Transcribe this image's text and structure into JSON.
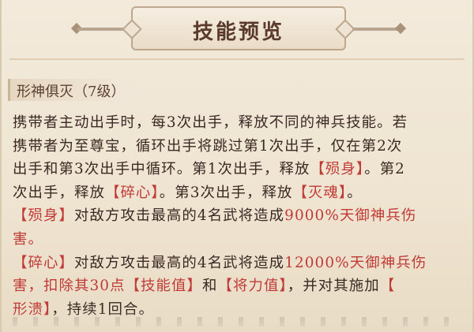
{
  "header": {
    "title": "技能预览"
  },
  "skill": {
    "name": "形神俱灭（7级）"
  },
  "description": {
    "l1": "携带者主动出手时，每3次出手，释放不同的神兵技能。若",
    "l2": "携带者为至尊宝，循环出手将跳过第1次出手，仅在第2次",
    "l3a": "出手和第3次出手中循环。第1次出手，释放",
    "l3b": "【殒身】",
    "l3c": "。第2",
    "l4a": "次出手，释放",
    "l4b": "【碎心】",
    "l4c": "。第3次出手，释放",
    "l4d": "【灭魂】",
    "l4e": "。",
    "l5a": "【殒身】",
    "l5b": "对敌方攻击最高的4名武将造成",
    "l5c": "9000%",
    "l5d": "天御神兵伤",
    "l6": "害。",
    "l7a": "【碎心】",
    "l7b": "对敌方攻击最高的4名武将造成",
    "l7c": "12000%",
    "l7d": "天御神兵伤",
    "l8a": "害，扣除其30点",
    "l8b": "【技能值】",
    "l8c": "和",
    "l8d": "【将力值】",
    "l8e": "，并对其施加",
    "l8f": "【",
    "l9a": "形溃】",
    "l9b": "，持续1回合。"
  },
  "colors": {
    "highlight": "#c03a36",
    "text": "#3b2a24",
    "title": "#5a3a2b"
  }
}
